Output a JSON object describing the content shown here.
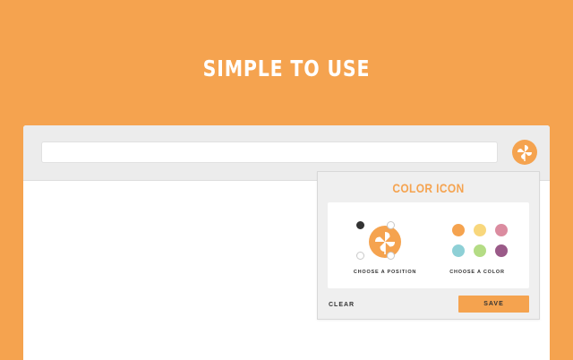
{
  "hero": {
    "title": "SIMPLE TO USE"
  },
  "toolbar": {
    "address_value": "",
    "extension_icon": "pinwheel-icon"
  },
  "popup": {
    "title": "COLOR ICON",
    "position": {
      "caption": "CHOOSE A POSITION",
      "options": [
        "top-left",
        "top-right",
        "bottom-left",
        "bottom-right"
      ],
      "selected": "top-left"
    },
    "color": {
      "caption": "CHOOSE A COLOR",
      "swatches": [
        "#f5a34f",
        "#f8d77c",
        "#db8ca0",
        "#8ed0d6",
        "#b4dc85",
        "#9a5a88"
      ]
    },
    "clear_label": "CLEAR",
    "save_label": "SAVE"
  },
  "colors": {
    "background": "#f5a34f",
    "accent": "#f5a34f",
    "toolbar": "#ececec",
    "popup_background": "#efefef"
  }
}
